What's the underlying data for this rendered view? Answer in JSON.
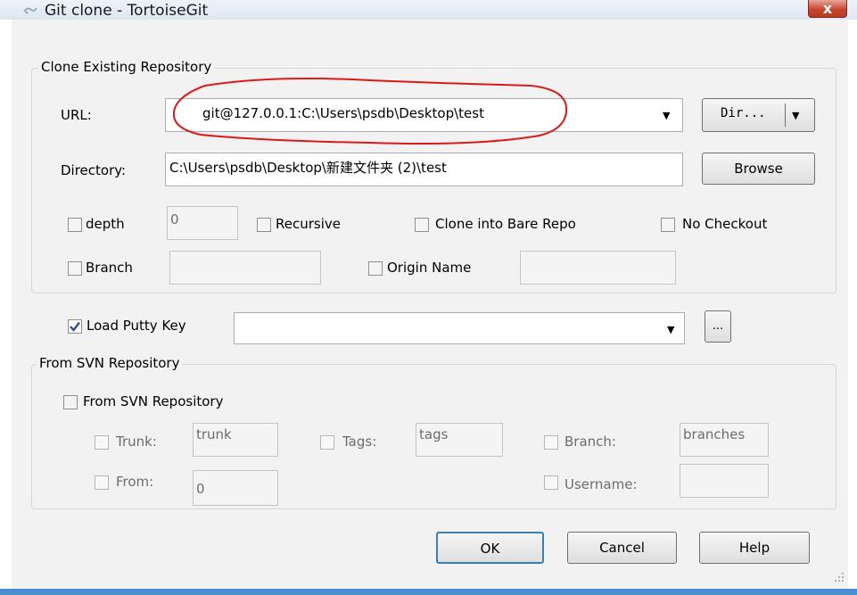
{
  "window": {
    "title": "Git clone - TortoiseGit",
    "close_glyph": "x"
  },
  "clone_group": {
    "legend": "Clone Existing Repository",
    "url_label": "URL:",
    "url_value": "git@127.0.0.1:C:\\Users\\psdb\\Desktop\\test",
    "dir_button": "Dir...",
    "directory_label": "Directory:",
    "directory_value": "C:\\Users\\psdb\\Desktop\\新建文件夹 (2)\\test",
    "browse_button": "Browse",
    "depth_label": "depth",
    "depth_value": "0",
    "recursive_label": "Recursive",
    "bare_label": "Clone into Bare Repo",
    "nocheckout_label": "No Checkout",
    "branch_label": "Branch",
    "branch_value": "",
    "origin_label": "Origin Name",
    "origin_value": ""
  },
  "putty": {
    "label": "Load Putty Key",
    "checked": true,
    "value": "",
    "browse_button": "..."
  },
  "svn_group": {
    "legend": "From SVN Repository",
    "checkbox_label": "From SVN Repository",
    "trunk_label": "Trunk:",
    "trunk_value": "trunk",
    "tags_label": "Tags:",
    "tags_value": "tags",
    "branch_label": "Branch:",
    "branch_value": "branches",
    "from_label": "From:",
    "from_value": "0",
    "username_label": "Username:",
    "username_value": ""
  },
  "buttons": {
    "ok": "OK",
    "cancel": "Cancel",
    "help": "Help"
  },
  "colors": {
    "annotation": "#d81a1a",
    "titlebar": "#dde6f1",
    "close": "#c8462f",
    "frame": "#4b8ecf"
  }
}
